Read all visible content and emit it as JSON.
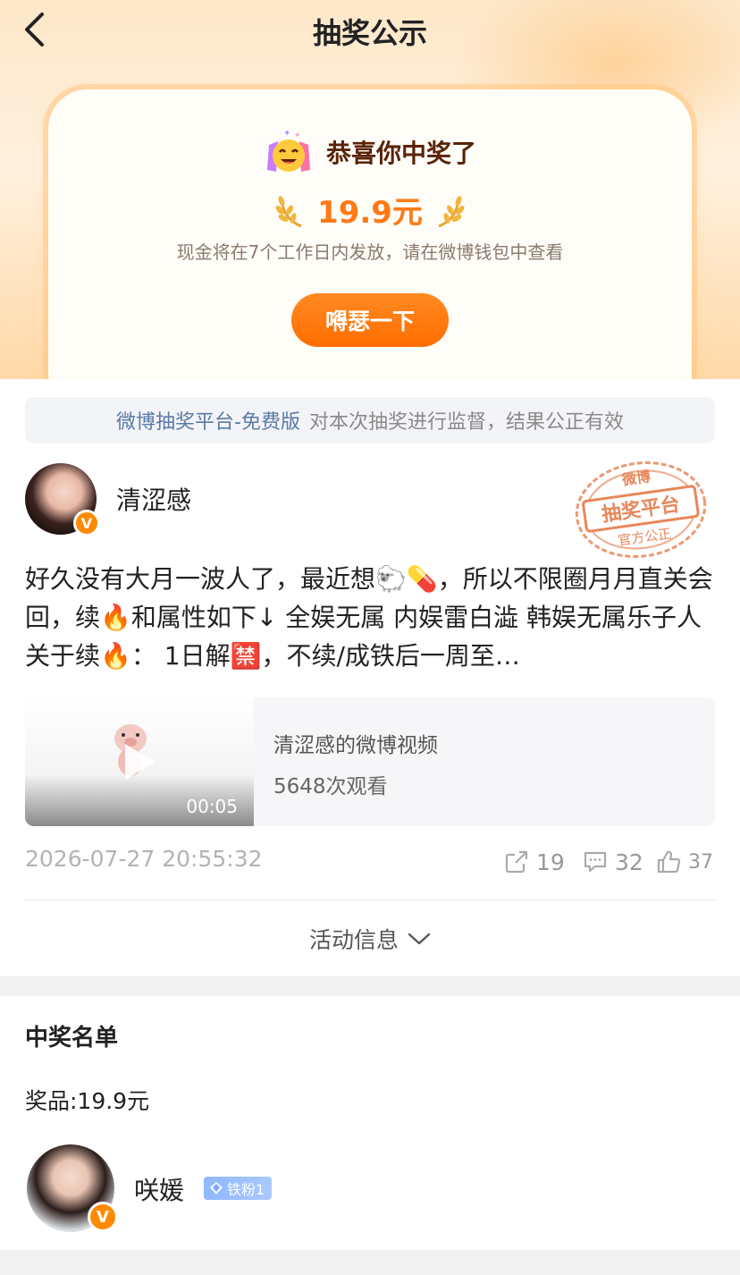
{
  "nav": {
    "title": "抽奖公示"
  },
  "prize_card": {
    "congrats": "恭喜你中奖了",
    "amount": "19.9元",
    "note": "现金将在7个工作日内发放，请在微博钱包中查看",
    "share_button": "嘚瑟一下"
  },
  "platform": {
    "link": "微博抽奖平台-免费版",
    "rest": "对本次抽奖进行监督，结果公正有效"
  },
  "author": {
    "name": "清涩感",
    "badge": "V"
  },
  "stamp": {
    "line1": "微博",
    "line2": "抽奖平台",
    "line3": "官方公正"
  },
  "post": {
    "text": "好久没有大月一波人了，最近想🐑💊，所以不限圈月月直关会回，续🔥和属性如下↓ 全娱无属 内娱雷白澁 韩娱无属乐子人 关于续🔥： 1日解🈲，不续/成铁后一周至…"
  },
  "video": {
    "title": "清涩感的微博视频",
    "views": "5648次观看",
    "duration": "00:05"
  },
  "meta": {
    "time": "2026-07-27 20:55:32",
    "reposts": "19",
    "comments": "32",
    "likes": "37"
  },
  "activity": {
    "label": "活动信息"
  },
  "winners": {
    "title": "中奖名单",
    "prize": "奖品:19.9元",
    "list": [
      {
        "name": "咲媛",
        "badge": "V",
        "fan_level": "铁粉1"
      }
    ]
  },
  "colors": {
    "accent": "#ff7a14",
    "link": "#5a7aa6",
    "brand_orange": "#ff8a00"
  }
}
